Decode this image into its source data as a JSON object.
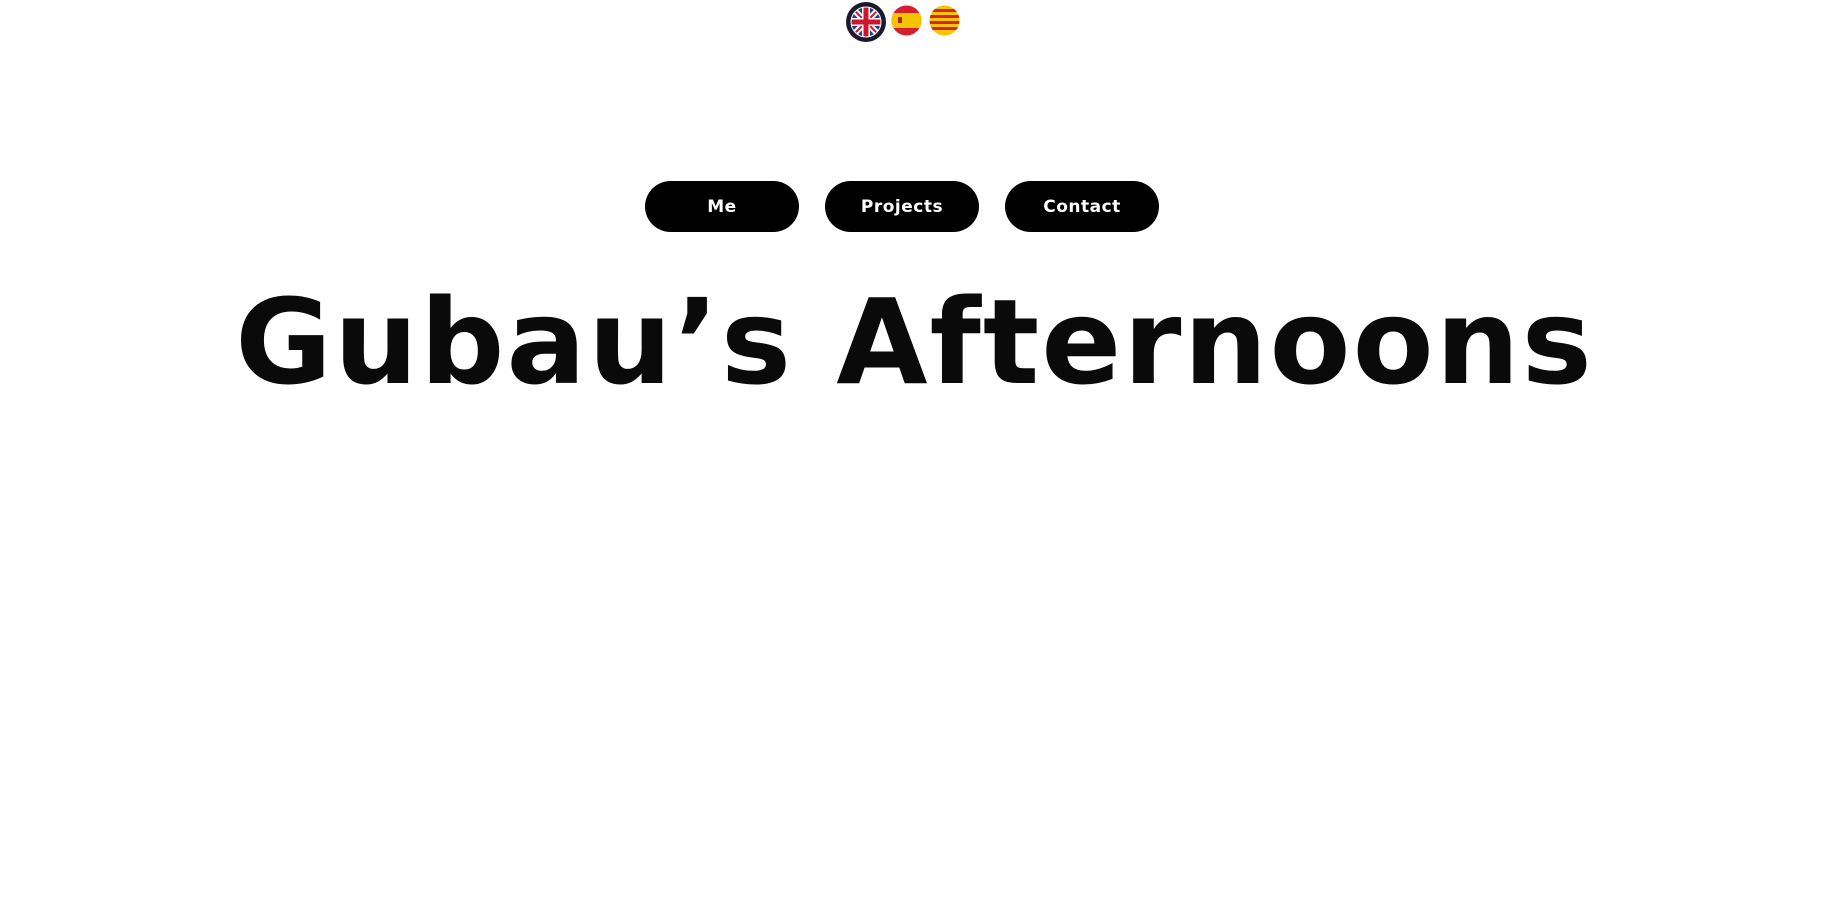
{
  "languages": [
    {
      "code": "en",
      "name": "English",
      "icon": "uk-flag-icon",
      "selected": true
    },
    {
      "code": "es",
      "name": "Español",
      "icon": "spain-flag-icon",
      "selected": false
    },
    {
      "code": "ca",
      "name": "Català",
      "icon": "catalonia-flag-icon",
      "selected": false
    }
  ],
  "nav": {
    "me_label": "Me",
    "projects_label": "Projects",
    "contact_label": "Contact"
  },
  "hero": {
    "title": "Gubau’s Afternoons"
  },
  "colors": {
    "background": "#ffffff",
    "button_bg": "#000000",
    "button_text": "#ffffff",
    "title_text": "#0a0a0a"
  }
}
